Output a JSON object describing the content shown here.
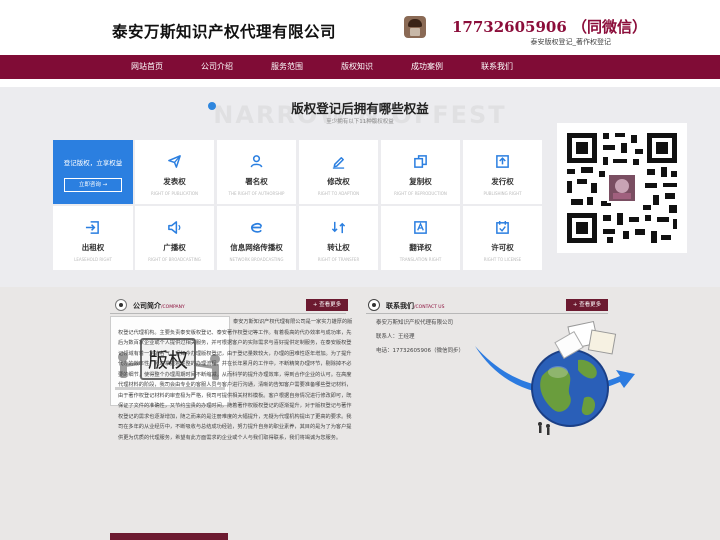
{
  "header": {
    "company_name": "泰安万斯知识产权代理有限公司",
    "hotline": "17732605906 （同微信）",
    "hotline_sub": "泰安版权登记_著作权登记"
  },
  "nav": {
    "items": [
      "网站首页",
      "公司介绍",
      "服务范围",
      "版权知识",
      "成功案例",
      "联系我们"
    ]
  },
  "services": {
    "title": "版权登记后拥有哪些权益",
    "watermark": "NARROW & OFFEST",
    "subtitle": "至少拥有以下11种版权权益",
    "promo": {
      "text": "登记版权，立享权益",
      "button": "立即咨询 →"
    },
    "cards": [
      {
        "title": "发表权",
        "en": "RIGHT OF PUBLICATION",
        "icon": "send-icon"
      },
      {
        "title": "署名权",
        "en": "THE RIGHT OF AUTHORSHIP",
        "icon": "user-icon"
      },
      {
        "title": "修改权",
        "en": "RIGHT TO ADAPTION",
        "icon": "edit-icon"
      },
      {
        "title": "复制权",
        "en": "RIGHT OF REPRODUCTION",
        "icon": "copy-icon"
      },
      {
        "title": "发行权",
        "en": "PUBLISHING RIGHT",
        "icon": "upload-icon"
      },
      {
        "title": "出租权",
        "en": "LEASEHOLD RIGHT",
        "icon": "lease-icon"
      },
      {
        "title": "广播权",
        "en": "RIGHT OF BROADCASTING",
        "icon": "broadcast-icon"
      },
      {
        "title": "信息网络传播权",
        "en": "NETWORK BROADCASTING",
        "icon": "network-icon"
      },
      {
        "title": "转让权",
        "en": "RIGHT OF TRANSFER",
        "icon": "transfer-icon"
      },
      {
        "title": "翻译权",
        "en": "TRANSLATION RIGHT",
        "icon": "translate-icon"
      },
      {
        "title": "许可权",
        "en": "RIGHT TO LICENSE",
        "icon": "license-icon"
      }
    ]
  },
  "about": {
    "title": "公司简介",
    "title_en": "/COMPANY",
    "more": "+ 查看更多",
    "image_text": "版权",
    "text": "泰安万斯知识产权代理有限公司是一家实力雄厚的版权登记代理机构。主要负责泰安版权登记、泰安著作权登记等工作。有着极高的代办效率与成功率，先后为数百家企业或个人提供过相关服务，并可根据客户的实际需求与喜好提供定制服务，在泰安版权登记领域有着一定的名气。现如今办理版权登记，由于登记量数较大，办理的困难性逐年增加。为了提升代办的效率性，我司掌握着完整的办理流程，并在长年累月的工作中，不断精简办理环节，剔除掉不必要的细节，使得整个办理周期时间不断缩减。从而科学的提升办理效率，得到合作企业的认可。在高度代理材料的阶段，我司会由专业的客服人员与客户进行沟通，清晰的告知客户需要准备哪些登记材料，由于著作权登记材料的审查极为严格，我司可提供相关材料模板。客户根据自身情况进行修改即可，既保证了文件的准确性，又节约宝贵的办理时间，随着著作权版权登记的逐渐提升，对于版权登记与著作权登记的需求也逐渐增加，随之而来的是注册难度的大幅提升，无疑为代理机构提出了更高的要求。我司在多年的从业经历中，不断吸收与总结成功经验，努力提升自身的职业素养，其目的是为了为客户提供更为优质的代理服务，希望有此方面需求的企业或个人与我们取得联系，我们将竭诚为您服务。"
  },
  "contact": {
    "title": "联系我们",
    "title_en": "/CONTACT US",
    "more": "+ 查看更多",
    "company": "泰安万斯知识产权代理有限公司",
    "person": "联系人：王经理",
    "phone": "电话：17732605906（微信同步）"
  },
  "colors": {
    "brand": "#800c36",
    "accent_blue": "#2b7fe0",
    "panel_bg": "#e9e7e6"
  }
}
